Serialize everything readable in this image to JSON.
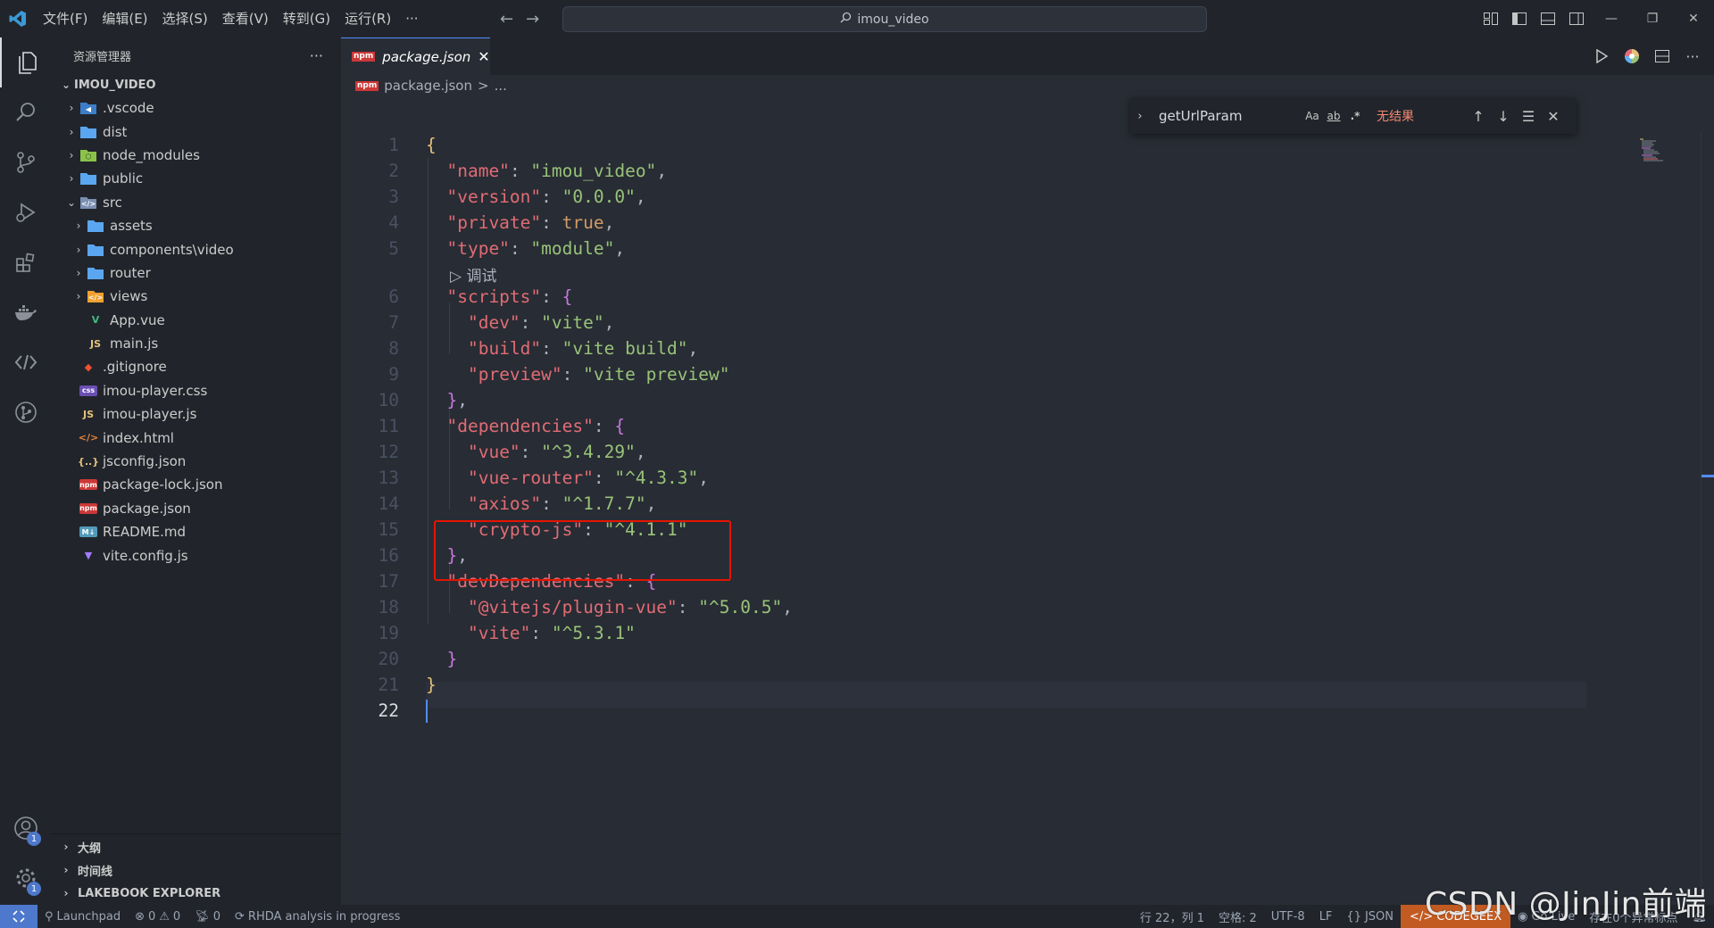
{
  "titlebar": {
    "menu": [
      "文件(F)",
      "编辑(E)",
      "选择(S)",
      "查看(V)",
      "转到(G)",
      "运行(R)",
      "···"
    ],
    "search_text": "imou_video"
  },
  "sidebar": {
    "title": "资源管理器",
    "more": "···",
    "root": "IMOU_VIDEO",
    "items": [
      {
        "label": ".vscode",
        "type": "folder",
        "icon": "vscode-folder-icon",
        "depth": 1,
        "expanded": false
      },
      {
        "label": "dist",
        "type": "folder",
        "icon": "folder-icon",
        "depth": 1,
        "expanded": false
      },
      {
        "label": "node_modules",
        "type": "folder",
        "icon": "node-folder-icon",
        "depth": 1,
        "expanded": false
      },
      {
        "label": "public",
        "type": "folder",
        "icon": "folder-icon",
        "depth": 1,
        "expanded": false
      },
      {
        "label": "src",
        "type": "folder",
        "icon": "src-folder-icon",
        "depth": 1,
        "expanded": true
      },
      {
        "label": "assets",
        "type": "folder",
        "icon": "folder-icon",
        "depth": 2,
        "expanded": false
      },
      {
        "label": "components\\video",
        "type": "folder",
        "icon": "folder-icon",
        "depth": 2,
        "expanded": false
      },
      {
        "label": "router",
        "type": "folder",
        "icon": "folder-icon",
        "depth": 2,
        "expanded": false
      },
      {
        "label": "views",
        "type": "folder",
        "icon": "views-folder-icon",
        "depth": 2,
        "expanded": false
      },
      {
        "label": "App.vue",
        "type": "file",
        "icon": "vue-icon",
        "depth": 2
      },
      {
        "label": "main.js",
        "type": "file",
        "icon": "js-icon",
        "depth": 2
      },
      {
        "label": ".gitignore",
        "type": "file",
        "icon": "git-icon",
        "depth": 1
      },
      {
        "label": "imou-player.css",
        "type": "file",
        "icon": "css-icon",
        "depth": 1
      },
      {
        "label": "imou-player.js",
        "type": "file",
        "icon": "js-icon",
        "depth": 1
      },
      {
        "label": "index.html",
        "type": "file",
        "icon": "html-icon",
        "depth": 1
      },
      {
        "label": "jsconfig.json",
        "type": "file",
        "icon": "json-icon",
        "depth": 1
      },
      {
        "label": "package-lock.json",
        "type": "file",
        "icon": "npm-icon",
        "depth": 1
      },
      {
        "label": "package.json",
        "type": "file",
        "icon": "npm-icon",
        "depth": 1
      },
      {
        "label": "README.md",
        "type": "file",
        "icon": "markdown-icon",
        "depth": 1
      },
      {
        "label": "vite.config.js",
        "type": "file",
        "icon": "vite-icon",
        "depth": 1
      }
    ],
    "sections": [
      "大纲",
      "时间线",
      "LAKEBOOK EXPLORER"
    ],
    "account_badge": "1",
    "settings_badge": "1"
  },
  "editor": {
    "tab_label": "package.json",
    "tab_close": "✕",
    "npm_badge": "npm",
    "breadcrumb_file": "package.json",
    "breadcrumb_sep": ">",
    "breadcrumb_more": "...",
    "codelens": "调试",
    "find": {
      "query": "getUrlParam",
      "opt_case": "Aa",
      "opt_word": "ab",
      "opt_regex": ".*",
      "result": "无结果"
    }
  },
  "statusbar": {
    "launchpad": "Launchpad",
    "errors": "0",
    "warnings": "0",
    "ports": "0",
    "rhda": "RHDA analysis in progress",
    "position": "行 22，列 1",
    "spaces": "空格: 2",
    "encoding": "UTF-8",
    "eol": "LF",
    "language": "JSON",
    "codegeex": "CODEGEEX",
    "golive": "Go Live",
    "problems_hint": "存在0个异常标点"
  },
  "watermark": "CSDN @JinJin前端"
}
